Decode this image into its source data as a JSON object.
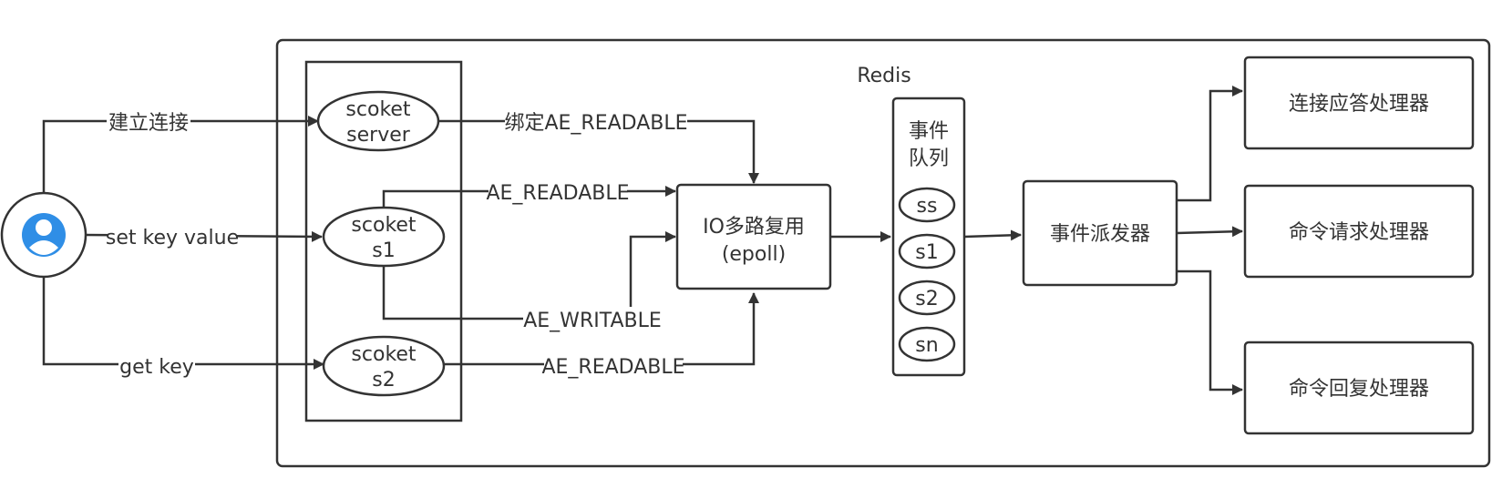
{
  "container_title": "Redis",
  "user": {
    "icon": "user-avatar-icon"
  },
  "sockets": {
    "server": {
      "line1": "scoket",
      "line2": "server"
    },
    "s1": {
      "line1": "scoket",
      "line2": "s1"
    },
    "s2": {
      "line1": "scoket",
      "line2": "s2"
    }
  },
  "edges": {
    "connect": "建立连接",
    "set_key": "set key value",
    "get_key": "get key",
    "bind_readable": "绑定AE_READABLE",
    "s1_readable": "AE_READABLE",
    "s1_writable": "AE_WRITABLE",
    "s2_readable": "AE_READABLE"
  },
  "io_multiplexing": {
    "line1": "IO多路复用",
    "line2": "(epoll)"
  },
  "event_queue": {
    "title_line1": "事件",
    "title_line2": "队列",
    "items": [
      "ss",
      "s1",
      "s2",
      "sn"
    ]
  },
  "dispatcher": {
    "label": "事件派发器"
  },
  "handlers": {
    "connect": "连接应答处理器",
    "request": "命令请求处理器",
    "reply": "命令回复处理器"
  },
  "colors": {
    "stroke": "#333333",
    "text": "#333333",
    "background": "#ffffff"
  }
}
